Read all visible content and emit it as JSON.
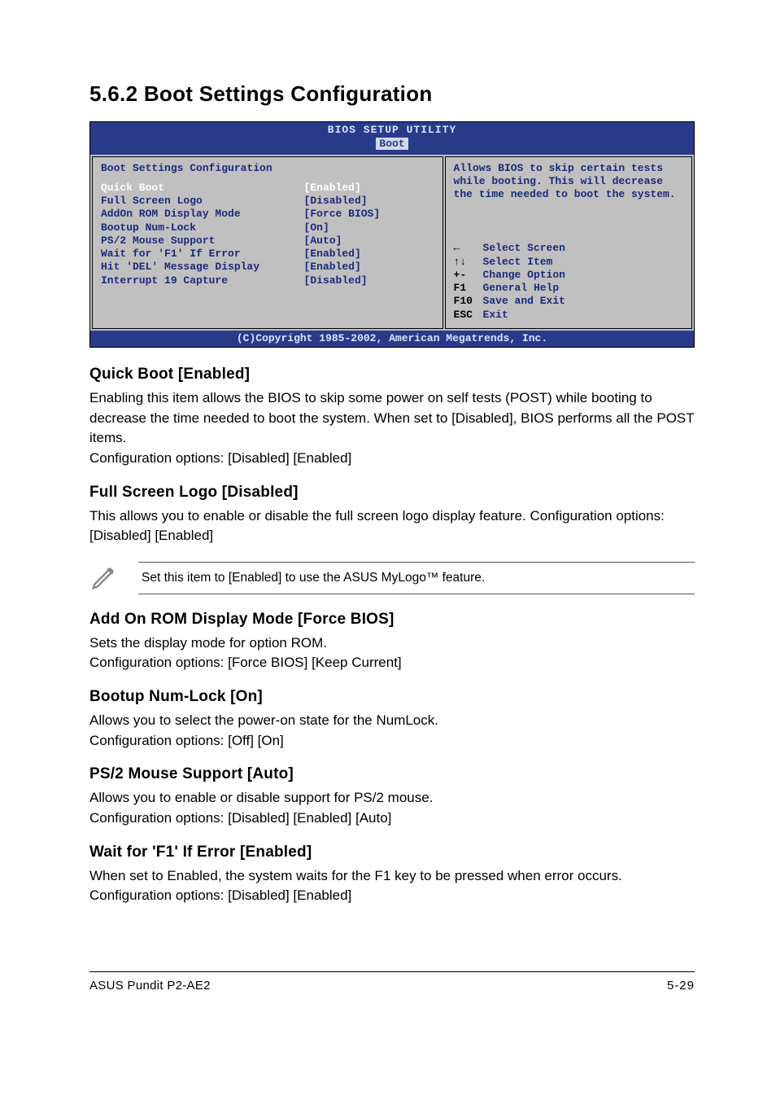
{
  "heading": "5.6.2   Boot Settings Configuration",
  "bios": {
    "title": "BIOS SETUP UTILITY",
    "subtitle": "Boot",
    "panelHeading": "Boot Settings Configuration",
    "rows": [
      {
        "label": "Quick Boot",
        "value": "[Enabled]",
        "selected": true
      },
      {
        "label": "Full Screen Logo",
        "value": "[Disabled]"
      },
      {
        "label": "AddOn ROM Display Mode",
        "value": "[Force BIOS]"
      },
      {
        "label": "Bootup Num-Lock",
        "value": "[On]"
      },
      {
        "label": "PS/2 Mouse Support",
        "value": "[Auto]"
      },
      {
        "label": "Wait for 'F1' If Error",
        "value": "[Enabled]"
      },
      {
        "label": "Hit 'DEL' Message Display",
        "value": "[Enabled]"
      },
      {
        "label": "Interrupt 19 Capture",
        "value": "[Disabled]"
      }
    ],
    "help": "Allows BIOS to skip certain tests while booting. This will decrease the time needed to boot the system.",
    "nav": [
      {
        "key": "←",
        "text": "Select Screen"
      },
      {
        "key": "↑↓",
        "text": "Select Item"
      },
      {
        "key": "+-",
        "text": "Change Option"
      },
      {
        "key": "F1",
        "text": "General Help"
      },
      {
        "key": "F10",
        "text": "Save and Exit"
      },
      {
        "key": "ESC",
        "text": "Exit"
      }
    ],
    "footer": "(C)Copyright 1985-2002, American Megatrends, Inc."
  },
  "items": {
    "quickBoot": {
      "title": "Quick Boot [Enabled]",
      "body": "Enabling this item allows the BIOS to skip some power on self tests (POST) while booting to decrease the time needed to boot the system. When set to [Disabled], BIOS performs all the POST items.\nConfiguration options: [Disabled] [Enabled]"
    },
    "fullScreenLogo": {
      "title": "Full Screen Logo [Disabled]",
      "body": "This allows you to enable or disable the full screen logo display feature. Configuration options: [Disabled] [Enabled]"
    },
    "note": "Set this item to [Enabled] to use the ASUS MyLogo™ feature.",
    "addOnRom": {
      "title": "Add On ROM Display Mode [Force BIOS]",
      "body": "Sets the display mode for option ROM.\nConfiguration options: [Force BIOS] [Keep Current]"
    },
    "numLock": {
      "title": "Bootup Num-Lock [On]",
      "body": "Allows you to select the power-on state for the NumLock.\nConfiguration options: [Off] [On]"
    },
    "ps2": {
      "title": "PS/2 Mouse Support [Auto]",
      "body": "Allows you to enable or disable support for PS/2 mouse.\nConfiguration options: [Disabled] [Enabled] [Auto]"
    },
    "waitF1": {
      "title": "Wait for 'F1' If Error [Enabled]",
      "body": "When set to Enabled, the system waits for the F1 key to be pressed when error occurs. Configuration options: [Disabled] [Enabled]"
    }
  },
  "footer": {
    "left": "ASUS Pundit P2-AE2",
    "right": "5-29"
  }
}
